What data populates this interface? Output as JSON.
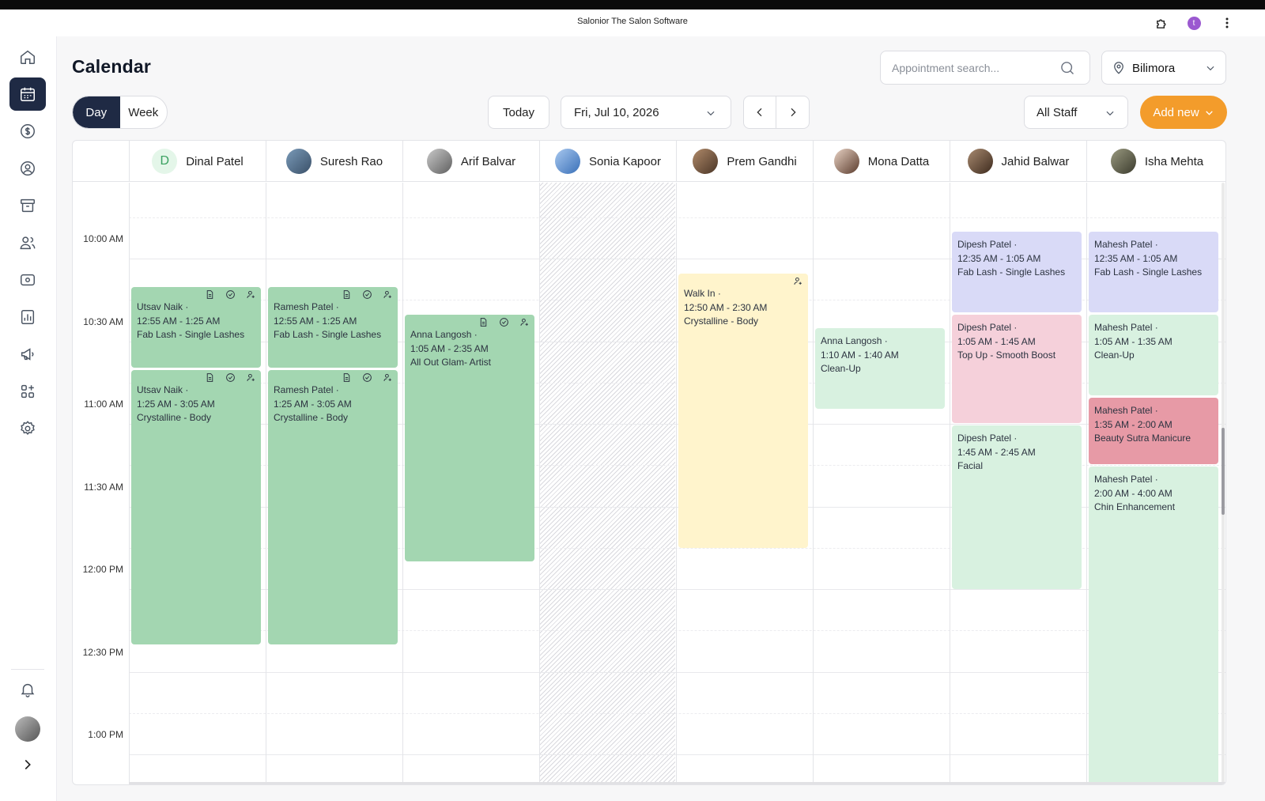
{
  "window": {
    "title": "Salonior The Salon Software",
    "avatar_letter": "t"
  },
  "sidebar": {
    "items": [
      {
        "name": "home-icon"
      },
      {
        "name": "calendar-icon",
        "active": true
      },
      {
        "name": "dollar-icon"
      },
      {
        "name": "user-circle-icon"
      },
      {
        "name": "archive-icon"
      },
      {
        "name": "users-icon"
      },
      {
        "name": "cash-icon"
      },
      {
        "name": "reports-icon"
      },
      {
        "name": "megaphone-icon"
      },
      {
        "name": "apps-add-icon"
      },
      {
        "name": "settings-icon"
      }
    ],
    "bottom": [
      {
        "name": "bell-icon"
      },
      {
        "name": "avatar"
      },
      {
        "name": "expand-chevron-icon"
      }
    ]
  },
  "header": {
    "title": "Calendar",
    "search_placeholder": "Appointment search...",
    "location": "Bilimora"
  },
  "toolbar": {
    "view_day": "Day",
    "view_week": "Week",
    "today": "Today",
    "date": "Fri, Jul 10, 2026",
    "staff_filter": "All Staff",
    "add_new": "Add new"
  },
  "calendar": {
    "staff": [
      {
        "name": "Dinal Patel",
        "initial": "D"
      },
      {
        "name": "Suresh Rao"
      },
      {
        "name": "Arif Balvar"
      },
      {
        "name": "Sonia Kapoor"
      },
      {
        "name": "Prem Gandhi"
      },
      {
        "name": "Mona Datta"
      },
      {
        "name": "Jahid Balwar"
      },
      {
        "name": "Isha Mehta"
      }
    ],
    "times": [
      "10:00 AM",
      "10:30 AM",
      "11:00 AM",
      "11:30 AM",
      "12:00 PM",
      "12:30 PM",
      "1:00 PM"
    ],
    "appointments": [
      {
        "client": "Utsav Naik ·",
        "time": "12:55 AM - 1:25 AM",
        "service": "Fab Lash - Single Lashes"
      },
      {
        "client": "Utsav Naik ·",
        "time": "1:25 AM - 3:05 AM",
        "service": "Crystalline - Body"
      },
      {
        "client": "Ramesh Patel ·",
        "time": "12:55 AM - 1:25 AM",
        "service": "Fab Lash - Single Lashes"
      },
      {
        "client": "Ramesh Patel ·",
        "time": "1:25 AM - 3:05 AM",
        "service": "Crystalline - Body"
      },
      {
        "client": "Anna Langosh ·",
        "time": "1:05 AM - 2:35 AM",
        "service": "All Out Glam- Artist"
      },
      {
        "client": "Walk In ·",
        "time": "12:50 AM - 2:30 AM",
        "service": "Crystalline - Body"
      },
      {
        "client": "Anna Langosh ·",
        "time": "1:10 AM - 1:40 AM",
        "service": "Clean-Up"
      },
      {
        "client": "Dipesh Patel ·",
        "time": "12:35 AM - 1:05 AM",
        "service": "Fab Lash - Single Lashes"
      },
      {
        "client": "Dipesh Patel ·",
        "time": "1:05 AM - 1:45 AM",
        "service": "Top Up - Smooth Boost"
      },
      {
        "client": "Dipesh Patel ·",
        "time": "1:45 AM - 2:45 AM",
        "service": "Facial"
      },
      {
        "client": "Mahesh Patel ·",
        "time": "12:35 AM - 1:05 AM",
        "service": "Fab Lash - Single Lashes"
      },
      {
        "client": "Mahesh Patel ·",
        "time": "1:05 AM - 1:35 AM",
        "service": "Clean-Up"
      },
      {
        "client": "Mahesh Patel ·",
        "time": "1:35 AM - 2:00 AM",
        "service": "Beauty Sutra Manicure"
      },
      {
        "client": "Mahesh Patel ·",
        "time": "2:00 AM - 4:00 AM",
        "service": "Chin Enhancement"
      }
    ]
  }
}
